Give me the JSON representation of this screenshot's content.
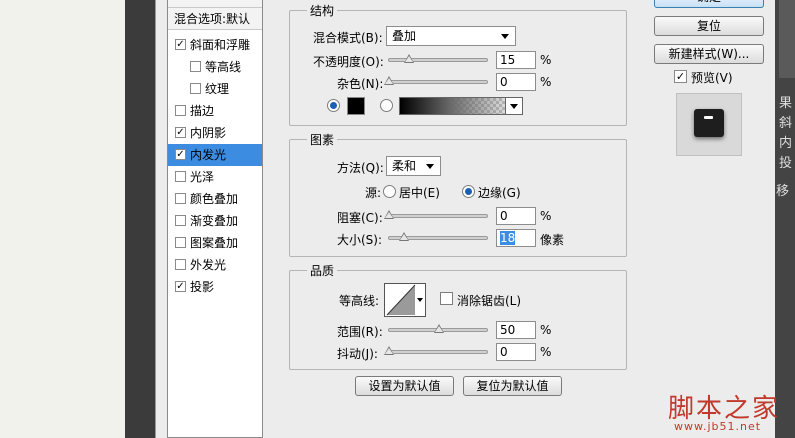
{
  "style_list": {
    "header": "混合选项:默认",
    "items": [
      {
        "label": "斜面和浮雕",
        "checked": true,
        "sub": false,
        "selected": false
      },
      {
        "label": "等高线",
        "checked": false,
        "sub": true,
        "selected": false
      },
      {
        "label": "纹理",
        "checked": false,
        "sub": true,
        "selected": false
      },
      {
        "label": "描边",
        "checked": false,
        "sub": false,
        "selected": false
      },
      {
        "label": "内阴影",
        "checked": true,
        "sub": false,
        "selected": false
      },
      {
        "label": "内发光",
        "checked": true,
        "sub": false,
        "selected": true
      },
      {
        "label": "光泽",
        "checked": false,
        "sub": false,
        "selected": false
      },
      {
        "label": "颜色叠加",
        "checked": false,
        "sub": false,
        "selected": false
      },
      {
        "label": "渐变叠加",
        "checked": false,
        "sub": false,
        "selected": false
      },
      {
        "label": "图案叠加",
        "checked": false,
        "sub": false,
        "selected": false
      },
      {
        "label": "外发光",
        "checked": false,
        "sub": false,
        "selected": false
      },
      {
        "label": "投影",
        "checked": true,
        "sub": false,
        "selected": false
      }
    ]
  },
  "structure": {
    "title": "结构",
    "blend_mode_label": "混合模式(B):",
    "blend_mode_value": "叠加",
    "opacity_label": "不透明度(O):",
    "opacity_value": "15",
    "opacity_unit": "%",
    "noise_label": "杂色(N):",
    "noise_value": "0",
    "noise_unit": "%",
    "color_swatch": "#000000"
  },
  "elements": {
    "title": "图素",
    "method_label": "方法(Q):",
    "method_value": "柔和",
    "source_label": "源:",
    "source_center": "居中(E)",
    "source_edge": "边缘(G)",
    "choke_label": "阻塞(C):",
    "choke_value": "0",
    "choke_unit": "%",
    "size_label": "大小(S):",
    "size_value": "18",
    "size_unit": "像素"
  },
  "quality": {
    "title": "品质",
    "contour_label": "等高线:",
    "antialias_label": "消除锯齿(L)",
    "range_label": "范围(R):",
    "range_value": "50",
    "range_unit": "%",
    "jitter_label": "抖动(J):",
    "jitter_value": "0",
    "jitter_unit": "%"
  },
  "bottom_buttons": {
    "make_default": "设置为默认值",
    "reset_default": "复位为默认值"
  },
  "side_buttons": {
    "ok": "确定",
    "reset": "复位",
    "new_style": "新建样式(W)...",
    "preview_label": "预览(V)"
  },
  "watermark": {
    "text": "脚本之家",
    "url": "www.jb51.net"
  },
  "right_panel_chars": [
    "果",
    "斜",
    "内",
    "投",
    "移"
  ]
}
